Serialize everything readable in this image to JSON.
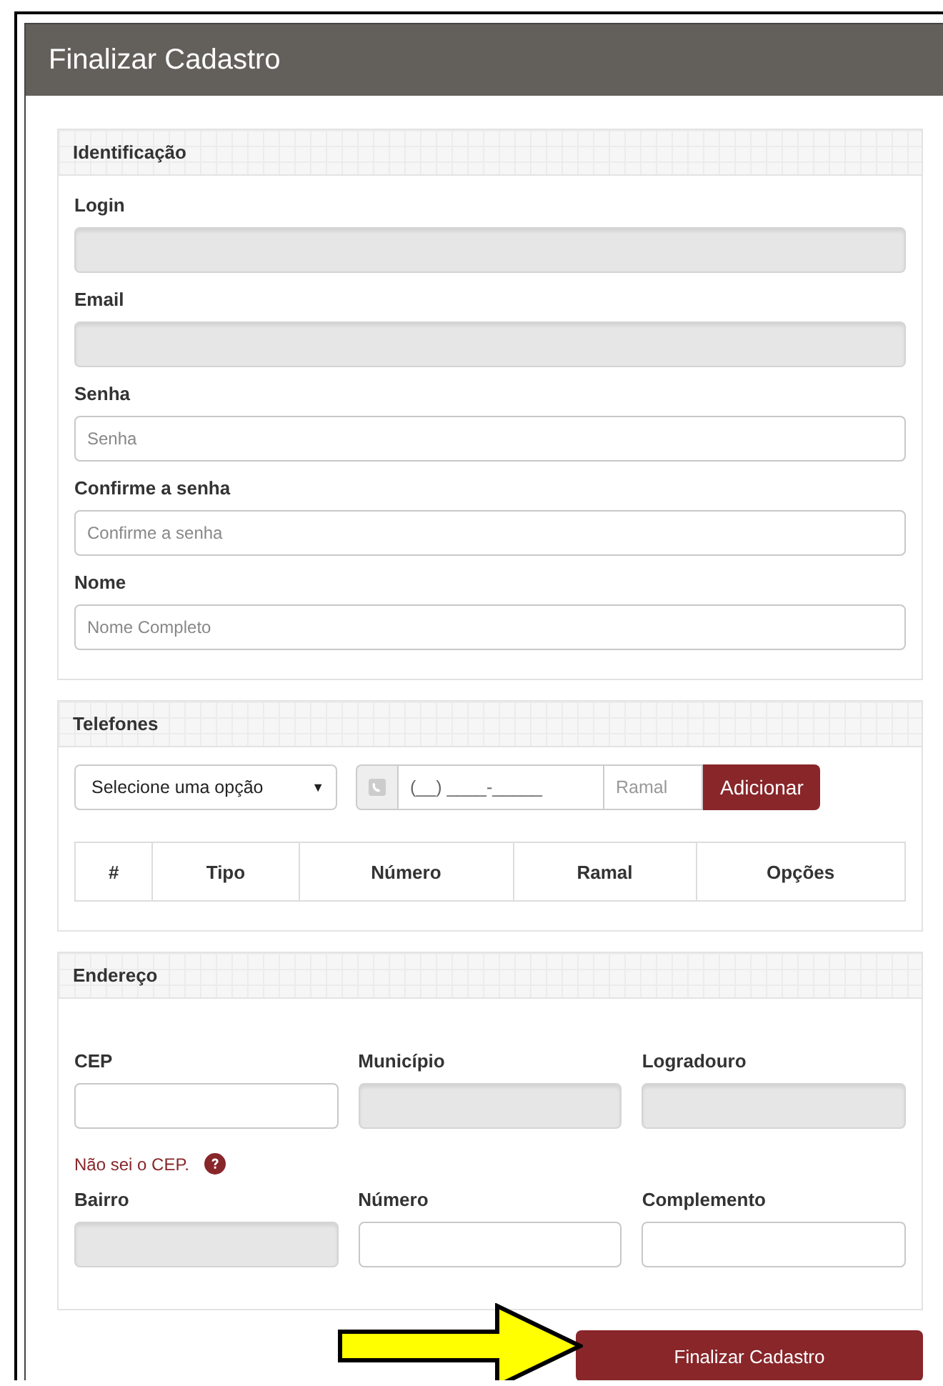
{
  "window": {
    "title": "Finalizar Cadastro"
  },
  "identification": {
    "title": "Identificação",
    "fields": [
      {
        "label": "Login",
        "disabled": true
      },
      {
        "label": "Email",
        "disabled": true
      },
      {
        "label": "Senha",
        "placeholder": "Senha",
        "disabled": false
      },
      {
        "label": "Confirme a senha",
        "placeholder": "Confirme a senha",
        "disabled": false
      },
      {
        "label": "Nome",
        "placeholder": "Nome Completo",
        "disabled": false
      }
    ]
  },
  "phones": {
    "title": "Telefones",
    "type_select": {
      "value": "Selecione uma opção",
      "arrow": "▼"
    },
    "number": {
      "placeholder": "(__) ____-_____"
    },
    "extension": {
      "placeholder": "Ramal"
    },
    "add_button": "Adicionar",
    "table": {
      "columns": [
        "#",
        "Tipo",
        "Número",
        "Ramal",
        "Opções"
      ]
    }
  },
  "address": {
    "title": "Endereço",
    "fields": [
      {
        "label": "CEP",
        "disabled": false
      },
      {
        "label": "Município",
        "disabled": true
      },
      {
        "label": "Logradouro",
        "disabled": true
      },
      {
        "label": "Bairro",
        "disabled": true
      },
      {
        "label": "Número",
        "disabled": false
      },
      {
        "label": "Complemento",
        "disabled": false
      }
    ],
    "help_link": "Não sei o CEP."
  },
  "submit_button": "Finalizar Cadastro"
}
